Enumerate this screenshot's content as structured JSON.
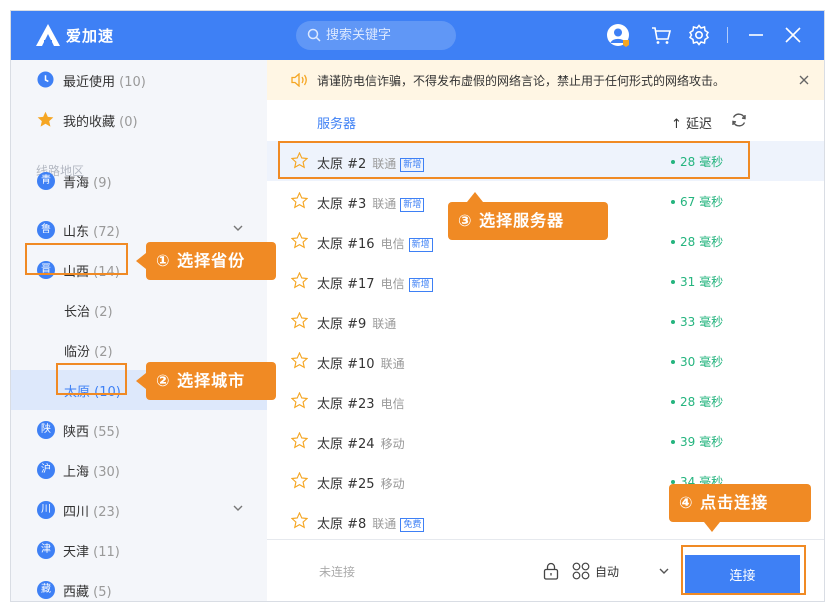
{
  "app": {
    "name": "爱加速"
  },
  "search": {
    "placeholder": "搜索关键字"
  },
  "sidebar": {
    "recent": {
      "label": "最近使用",
      "count": "(10)"
    },
    "favorites": {
      "label": "我的收藏",
      "count": "(0)"
    },
    "section_label": "线路地区",
    "provinces": [
      {
        "badge": "青",
        "label": "青海",
        "count": "(9)"
      },
      {
        "badge": "鲁",
        "label": "山东",
        "count": "(72)"
      },
      {
        "badge": "晋",
        "label": "山西",
        "count": "(14)"
      },
      {
        "badge": "陕",
        "label": "陕西",
        "count": "(55)"
      },
      {
        "badge": "沪",
        "label": "上海",
        "count": "(30)"
      },
      {
        "badge": "川",
        "label": "四川",
        "count": "(23)"
      },
      {
        "badge": "津",
        "label": "天津",
        "count": "(11)"
      },
      {
        "badge": "藏",
        "label": "西藏",
        "count": "(5)"
      }
    ],
    "cities": [
      {
        "label": "长治",
        "count": "(2)"
      },
      {
        "label": "临汾",
        "count": "(2)"
      },
      {
        "label": "太原",
        "count": "(10)"
      }
    ]
  },
  "notice": {
    "text": "请谨防电信诈骗，不得发布虚假的网络言论，禁止用于任何形式的网络攻击。"
  },
  "list_header": {
    "server": "服务器",
    "latency": "↑ 延迟"
  },
  "servers": [
    {
      "name": "太原 #2",
      "isp": "联通",
      "tag": "新增",
      "latency": "28 毫秒"
    },
    {
      "name": "太原 #3",
      "isp": "联通",
      "tag": "新增",
      "latency": "67 毫秒"
    },
    {
      "name": "太原 #16",
      "isp": "电信",
      "tag": "新增",
      "latency": "28 毫秒"
    },
    {
      "name": "太原 #17",
      "isp": "电信",
      "tag": "新增",
      "latency": "31 毫秒"
    },
    {
      "name": "太原 #9",
      "isp": "联通",
      "tag": "",
      "latency": "33 毫秒"
    },
    {
      "name": "太原 #10",
      "isp": "联通",
      "tag": "",
      "latency": "30 毫秒"
    },
    {
      "name": "太原 #23",
      "isp": "电信",
      "tag": "",
      "latency": "28 毫秒"
    },
    {
      "name": "太原 #24",
      "isp": "移动",
      "tag": "",
      "latency": "39 毫秒"
    },
    {
      "name": "太原 #25",
      "isp": "移动",
      "tag": "",
      "latency": "34 毫秒"
    },
    {
      "name": "太原 #8",
      "isp": "联通",
      "tag": "免费",
      "latency": ""
    }
  ],
  "footer": {
    "status": "未连接",
    "mode": "自动",
    "connect": "连接"
  },
  "annotations": {
    "step1": "① 选择省份",
    "step2": "② 选择城市",
    "step3": "③ 选择服务器",
    "step4": "④ 点击连接"
  },
  "colors": {
    "primary": "#3e80f5",
    "annotation": "#f08a24",
    "latency": "#24b47e",
    "notice_bg": "#fff6e4"
  }
}
